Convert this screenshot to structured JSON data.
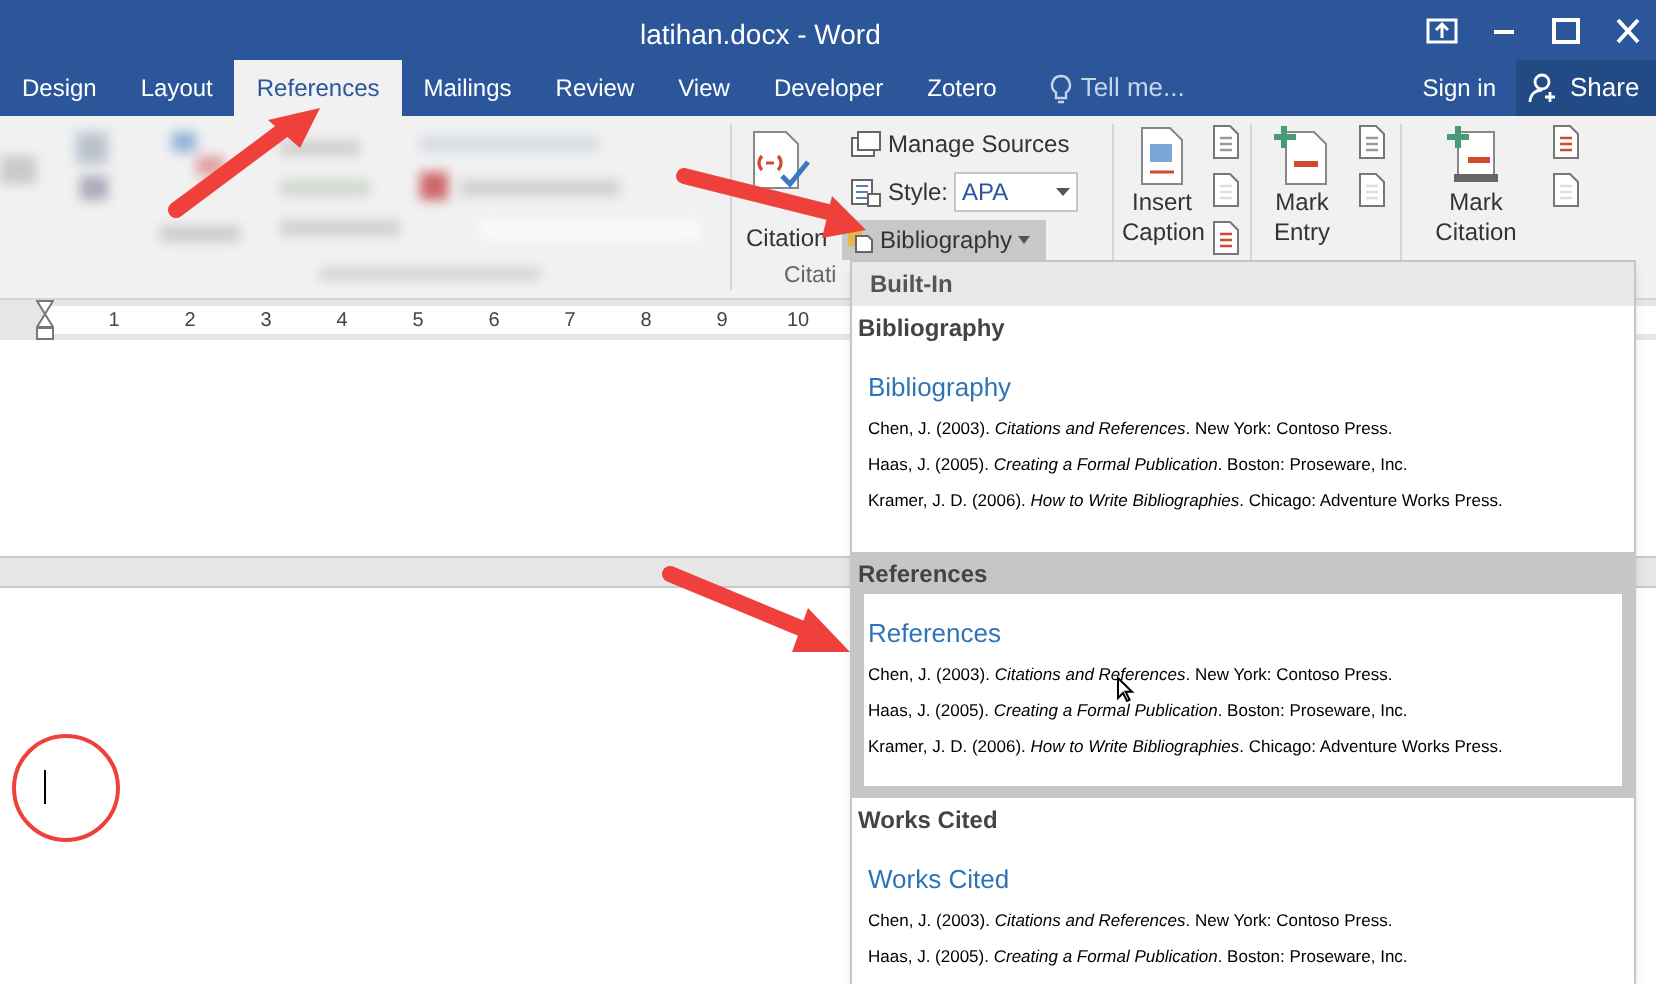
{
  "window": {
    "title": "latihan.docx - Word"
  },
  "tabs": [
    {
      "label": "Design",
      "selected": false
    },
    {
      "label": "Layout",
      "selected": false
    },
    {
      "label": "References",
      "selected": true
    },
    {
      "label": "Mailings",
      "selected": false
    },
    {
      "label": "Review",
      "selected": false
    },
    {
      "label": "View",
      "selected": false
    },
    {
      "label": "Developer",
      "selected": false
    },
    {
      "label": "Zotero",
      "selected": false
    }
  ],
  "tell_me": {
    "placeholder": "Tell me..."
  },
  "account": {
    "sign_in": "Sign in",
    "share": "Share"
  },
  "ribbon": {
    "citations": {
      "insert_citation": "Citation",
      "manage_sources": "Manage Sources",
      "style_label": "Style:",
      "style_value": "APA",
      "bibliography": "Bibliography",
      "group_label": "Citati"
    },
    "insert_caption": "Insert Caption",
    "mark_entry": "Mark Entry",
    "mark_citation": "Mark Citation"
  },
  "ruler": {
    "numbers": [
      "1",
      "2",
      "3",
      "4",
      "5",
      "6",
      "7",
      "8",
      "9",
      "10"
    ]
  },
  "bibliography_menu": {
    "header": "Built-In",
    "sections": [
      {
        "heading": "Bibliography",
        "title": "Bibliography",
        "selected": false,
        "entries": [
          "Chen, J. (2003). *Citations and References*. New York: Contoso Press.",
          "Haas, J. (2005). *Creating a Formal Publication*. Boston: Proseware, Inc.",
          "Kramer, J. D. (2006). *How to Write Bibliographies*. Chicago: Adventure Works Press."
        ]
      },
      {
        "heading": "References",
        "title": "References",
        "selected": true,
        "entries": [
          "Chen, J. (2003). *Citations and References*. New York: Contoso Press.",
          "Haas, J. (2005). *Creating a Formal Publication*. Boston: Proseware, Inc.",
          "Kramer, J. D. (2006). *How to Write Bibliographies*. Chicago: Adventure Works Press."
        ]
      },
      {
        "heading": "Works Cited",
        "title": "Works Cited",
        "selected": false,
        "entries": [
          "Chen, J. (2003). *Citations and References*. New York: Contoso Press.",
          "Haas, J. (2005). *Creating a Formal Publication*. Boston: Proseware, Inc."
        ]
      }
    ]
  }
}
